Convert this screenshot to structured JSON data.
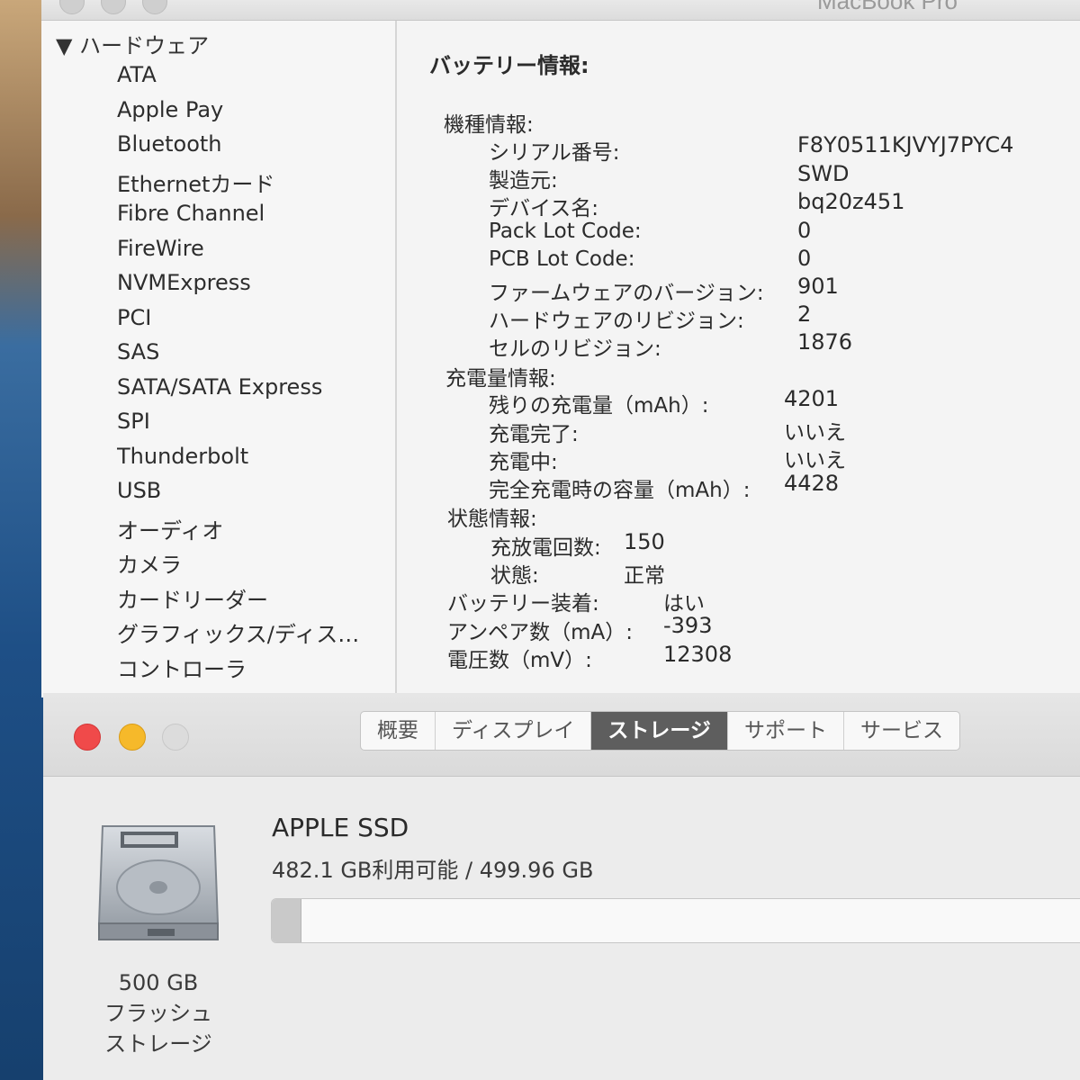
{
  "sysinfo": {
    "title": "MacBook Pro",
    "sidebar": {
      "header": "▼ ハードウェア",
      "items": [
        "ATA",
        "Apple Pay",
        "Bluetooth",
        "Ethernetカード",
        "Fibre Channel",
        "FireWire",
        "NVMExpress",
        "PCI",
        "SAS",
        "SATA/SATA Express",
        "SPI",
        "Thunderbolt",
        "USB",
        "オーディオ",
        "カメラ",
        "カードリーダー",
        "グラフィックス/ディス…",
        "コントローラ"
      ]
    },
    "battery": {
      "heading": "バッテリー情報:",
      "model_section": "機種情報:",
      "model_rows": [
        {
          "label": "シリアル番号:",
          "value": "F8Y0511KJVYJ7PYC4"
        },
        {
          "label": "製造元:",
          "value": "SWD"
        },
        {
          "label": "デバイス名:",
          "value": "bq20z451"
        },
        {
          "label": "Pack Lot Code:",
          "value": "0"
        },
        {
          "label": "PCB Lot Code:",
          "value": "0"
        },
        {
          "label": "ファームウェアのバージョン:",
          "value": "901"
        },
        {
          "label": "ハードウェアのリビジョン:",
          "value": "2"
        },
        {
          "label": "セルのリビジョン:",
          "value": "1876"
        }
      ],
      "charge_section": "充電量情報:",
      "charge_rows": [
        {
          "label": "残りの充電量（mAh）:",
          "value": "4201"
        },
        {
          "label": "充電完了:",
          "value": "いいえ"
        },
        {
          "label": "充電中:",
          "value": "いいえ"
        },
        {
          "label": "完全充電時の容量（mAh）:",
          "value": "4428"
        }
      ],
      "status_section": "状態情報:",
      "status_rows": [
        {
          "label": "充放電回数:",
          "value": "150"
        },
        {
          "label": "状態:",
          "value": "正常"
        }
      ],
      "top_rows": [
        {
          "label": "バッテリー装着:",
          "value": "はい"
        },
        {
          "label": "アンペア数（mA）:",
          "value": "-393"
        },
        {
          "label": "電圧数（mV）:",
          "value": "12308"
        }
      ]
    }
  },
  "about": {
    "tabs": [
      "概要",
      "ディスプレイ",
      "ストレージ",
      "サポート",
      "サービス"
    ],
    "active_tab": "ストレージ",
    "storage": {
      "disk_name": "APPLE SSD",
      "capacity_text": "482.1 GB利用可能 / 499.96 GB",
      "used_fraction": 0.036,
      "caption_line1": "500 GB",
      "caption_line2": "フラッシュ",
      "caption_line3": "ストレージ"
    }
  }
}
